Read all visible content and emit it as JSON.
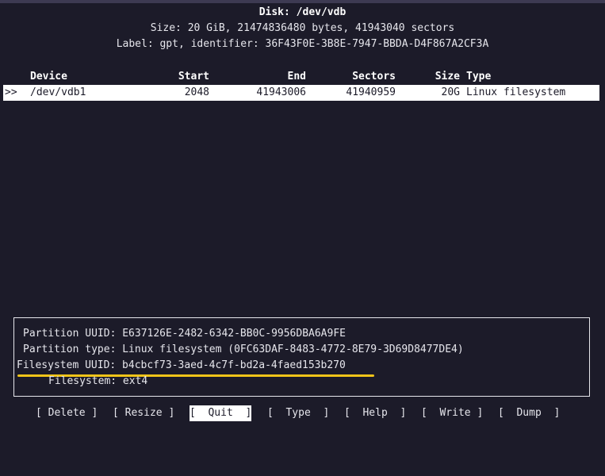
{
  "disk": {
    "title": "Disk: /dev/vdb",
    "size_line": "Size: 20 GiB, 21474836480 bytes, 41943040 sectors",
    "label_line": "Label: gpt, identifier: 36F43F0E-3B8E-7947-BBDA-D4F867A2CF3A"
  },
  "table": {
    "headers": {
      "device": "Device",
      "start": "Start",
      "end": "End",
      "sectors": "Sectors",
      "size": "Size",
      "type": "Type"
    },
    "rows": [
      {
        "marker": ">>",
        "device": "/dev/vdb1",
        "start": "2048",
        "end": "41943006",
        "sectors": "41940959",
        "size": "20G",
        "type": "Linux filesystem"
      }
    ]
  },
  "info": {
    "partition_uuid": "Partition UUID: E637126E-2482-6342-BB0C-9956DBA6A9FE",
    "partition_type": "Partition type: Linux filesystem (0FC63DAF-8483-4772-8E79-3D69D8477DE4)",
    "filesystem_uuid": "Filesystem UUID: b4cbcf73-3aed-4c7f-bd2a-4faed153b270",
    "filesystem": "Filesystem: ext4"
  },
  "menu": [
    {
      "label": "[ Delete ]",
      "active": false
    },
    {
      "label": "[ Resize ]",
      "active": false
    },
    {
      "label": "[  Quit  ]",
      "active": true
    },
    {
      "label": "[  Type  ]",
      "active": false
    },
    {
      "label": "[  Help  ]",
      "active": false
    },
    {
      "label": "[  Write ]",
      "active": false
    },
    {
      "label": "[  Dump  ]",
      "active": false
    }
  ],
  "colors": {
    "background": "#1c1b29",
    "foreground": "#e6e6ec",
    "selection": "#ffffff",
    "highlight_underline": "#f0c419"
  }
}
